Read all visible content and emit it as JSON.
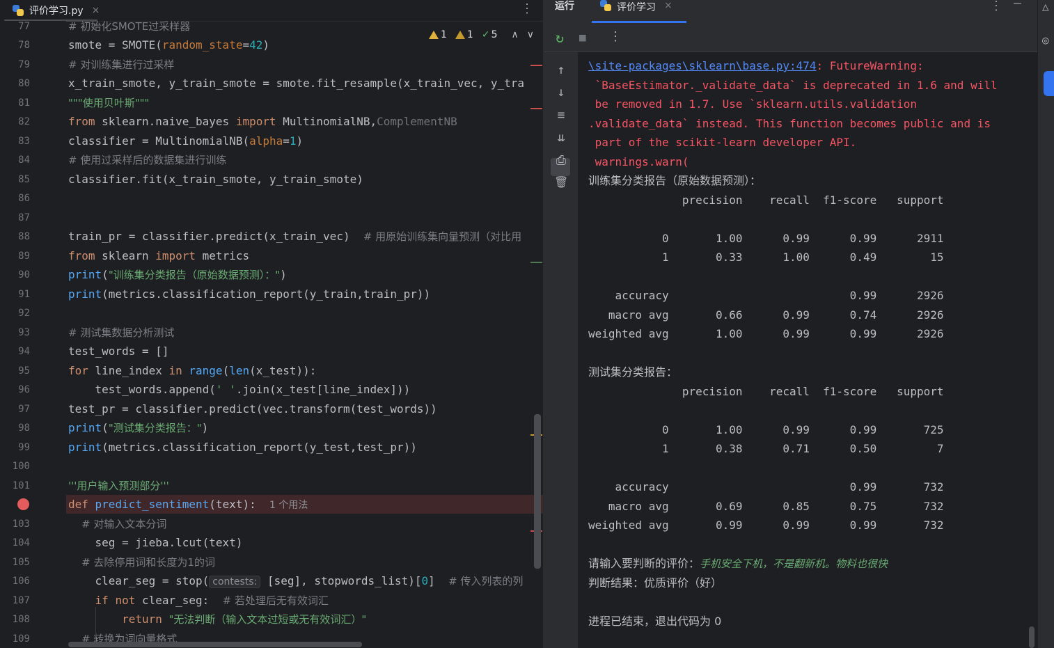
{
  "editor": {
    "tab_label": "评价学习.py",
    "tab_close": "×",
    "menu_glyph": "⋮",
    "inspections": {
      "warn1": "1",
      "warn2": "1",
      "ok": "5",
      "up": "∧",
      "down": "∨"
    },
    "line_numbers": [
      "77",
      "78",
      "79",
      "80",
      "81",
      "82",
      "83",
      "84",
      "85",
      "86",
      "87",
      "88",
      "89",
      "90",
      "91",
      "92",
      "93",
      "94",
      "95",
      "96",
      "97",
      "98",
      "99",
      "100",
      "101",
      "",
      "103",
      "104",
      "105",
      "106",
      "107",
      "108",
      "109"
    ],
    "lines": {
      "l77": "# 初始化SMOTE过采样器",
      "l78a": "smote = SMOTE(",
      "l78b": "random_state",
      "l78c": "=",
      "l78d": "42",
      "l78e": ")",
      "l79": "# 对训练集进行过采样",
      "l80": "x_train_smote, y_train_smote = smote.fit_resample(x_train_vec, y_tra",
      "l81": "\"\"\"使用贝叶斯\"\"\"",
      "l82a": "from",
      "l82b": " sklearn.naive_bayes ",
      "l82c": "import",
      "l82d": " MultinomialNB,",
      "l82e": "ComplementNB",
      "l83a": "classifier = MultinomialNB(",
      "l83b": "alpha",
      "l83c": "=",
      "l83d": "1",
      "l83e": ")",
      "l84": "# 使用过采样后的数据集进行训练",
      "l85": "classifier.fit(x_train_smote, y_train_smote)",
      "l88a": "train_pr = classifier.predict(x_train_vec)  ",
      "l88b": "# 用原始训练集向量预测（对比用",
      "l89a": "from",
      "l89b": " sklearn ",
      "l89c": "import",
      "l89d": " metrics",
      "l90a": "print",
      "l90b": "(",
      "l90c": "\"训练集分类报告（原始数据预测）：\"",
      "l90d": ")",
      "l91a": "print",
      "l91b": "(metrics.classification_report(y_train,train_pr))",
      "l93": "# 测试集数据分析测试",
      "l94": "test_words = []",
      "l95a": "for",
      "l95b": " line_index ",
      "l95c": "in",
      "l95d": " range",
      "l95e": "(",
      "l95f": "len",
      "l95g": "(x_test)):",
      "l96a": "    test_words.append(",
      "l96b": "' '",
      "l96c": ".join(x_test[line_index]))",
      "l97": "test_pr = classifier.predict(vec.transform(test_words))",
      "l98a": "print",
      "l98b": "(",
      "l98c": "\"测试集分类报告：\"",
      "l98d": ")",
      "l99a": "print",
      "l99b": "(metrics.classification_report(y_test,test_pr))",
      "l101": "'''用户输入预测部分'''",
      "l102a": "def",
      "l102b": " predict_sentiment",
      "l102c": "(text):  ",
      "l102d": "1 个用法",
      "l103": "    # 对输入文本分词",
      "l104": "    seg = jieba.lcut(text)",
      "l105": "    # 去除停用词和长度为1的词",
      "l106a": "    clear_seg = stop(",
      "l106b": "contests:",
      "l106c": " [seg], stopwords_list)[",
      "l106d": "0",
      "l106e": "]  ",
      "l106f": "# 传入列表的列",
      "l107a": "    ",
      "l107b": "if",
      "l107c": " ",
      "l107d": "not",
      "l107e": " clear_seg:  ",
      "l107f": "# 若处理后无有效词汇",
      "l108a": "        ",
      "l108b": "return",
      "l108c": " ",
      "l108d": "\"无法判断（输入文本过短或无有效词汇）\"",
      "l109": "    # 转换为词向量格式"
    }
  },
  "run": {
    "title": "运行",
    "tab_label": "评价学习",
    "tab_close": "×",
    "menu_glyph": "⋮",
    "min_glyph": "—",
    "toolbar": {
      "rerun": "↻",
      "stop": "■",
      "more": "⋮"
    },
    "side": {
      "up": "↑",
      "down": "↓",
      "wrap": "≡",
      "scroll_end": "⇊",
      "print": "⎙",
      "trash": "🗑"
    },
    "console": {
      "warn_link": "\\site-packages\\sklearn\\base.py:474",
      "warn_1": ": FutureWarning:",
      "warn_2": " `BaseEstimator._validate_data` is deprecated in 1.6 and will",
      "warn_3": " be removed in 1.7. Use `sklearn.utils.validation",
      "warn_4": ".validate_data` instead. This function becomes public and is",
      "warn_5": " part of the scikit-learn developer API.",
      "warn_6": " warnings.warn(",
      "train_header": "训练集分类报告（原始数据预测）：",
      "train_cols": "              precision    recall  f1-score   support",
      "train_r0": "           0       1.00      0.99      0.99      2911",
      "train_r1": "           1       0.33      1.00      0.49        15",
      "train_acc": "    accuracy                           0.99      2926",
      "train_macro": "   macro avg       0.66      0.99      0.74      2926",
      "train_weighted": "weighted avg       1.00      0.99      0.99      2926",
      "test_header": "测试集分类报告：",
      "test_cols": "              precision    recall  f1-score   support",
      "test_r0": "           0       1.00      0.99      0.99       725",
      "test_r1": "           1       0.38      0.71      0.50         7",
      "test_acc": "    accuracy                           0.99       732",
      "test_macro": "   macro avg       0.69      0.85      0.75       732",
      "test_weighted": "weighted avg       0.99      0.99      0.99       732",
      "prompt": "请输入要判断的评价：",
      "user_input": "手机安全下机，不是翻新机。物料也很快",
      "result": "判断结果：优质评价（好）",
      "exit": "进程已结束，退出代码为 0"
    }
  },
  "colors": {
    "accent": "#3574f0",
    "error_red": "#f75464",
    "breakpoint": "#e55c5c",
    "keyword": "#cf8e6d",
    "string": "#6aab73"
  }
}
